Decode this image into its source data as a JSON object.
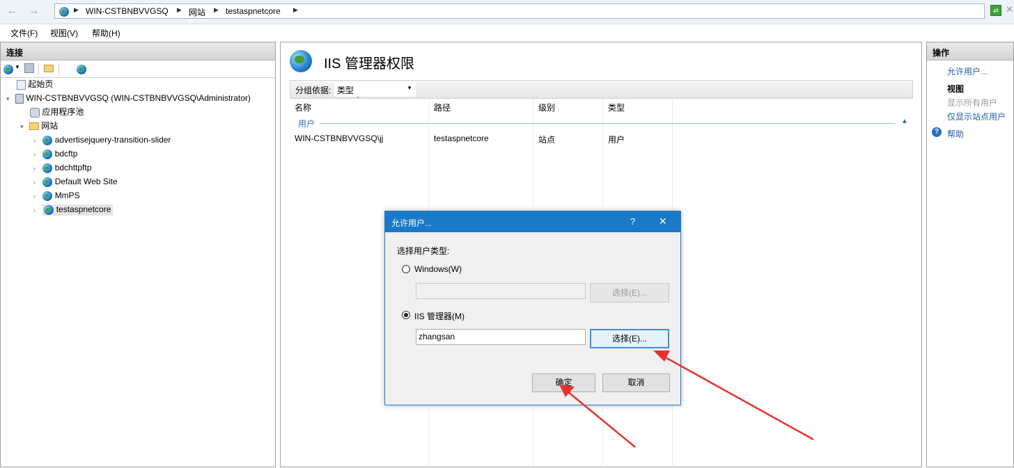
{
  "address": {
    "segments": [
      "WIN-CSTBNBVVGSQ",
      "网站",
      "testaspnetcore"
    ]
  },
  "menubar": {
    "file": "文件(F)",
    "view": "视图(V)",
    "help": "帮助(H)"
  },
  "connections": {
    "title": "连接",
    "tree": {
      "start_page": "起始页",
      "server": "WIN-CSTBNBVVGSQ (WIN-CSTBNBVVGSQ\\Administrator)",
      "app_pools": "应用程序池",
      "sites": "网站",
      "site_items": [
        "advertisejquery-transition-slider",
        "bdcftp",
        "bdchttpftp",
        "Default Web Site",
        "MmPS",
        "testaspnetcore"
      ]
    }
  },
  "main": {
    "title": "IIS 管理器权限",
    "group_by_label": "分组依据:",
    "group_by_value": "类型",
    "columns": [
      "名称",
      "路径",
      "级别",
      "类型"
    ],
    "group_header": "用户",
    "rows": [
      {
        "name": "WIN-CSTBNBVVGSQ\\jj",
        "path": "testaspnetcore",
        "level": "站点",
        "type": "用户"
      }
    ]
  },
  "actions": {
    "title": "操作",
    "allow_user": "允许用户...",
    "view_header": "视图",
    "show_all_users": "显示所有用户",
    "show_site_users": "仅显示站点用户",
    "help": "帮助"
  },
  "dialog": {
    "title": "允许用户...",
    "help_glyph": "?",
    "close_glyph": "✕",
    "prompt": "选择用户类型:",
    "windows_label": "Windows(W)",
    "windows_value": "",
    "windows_select": "选择(E)...",
    "iis_label": "IIS 管理器(M)",
    "iis_value": "zhangsan",
    "iis_select": "选择(E)...",
    "ok": "确定",
    "cancel": "取消",
    "selected_type": "iis"
  },
  "colors": {
    "dialog_title_bg": "#1a7ac7",
    "link": "#1f5fa8",
    "arrow": "#e8312f"
  }
}
